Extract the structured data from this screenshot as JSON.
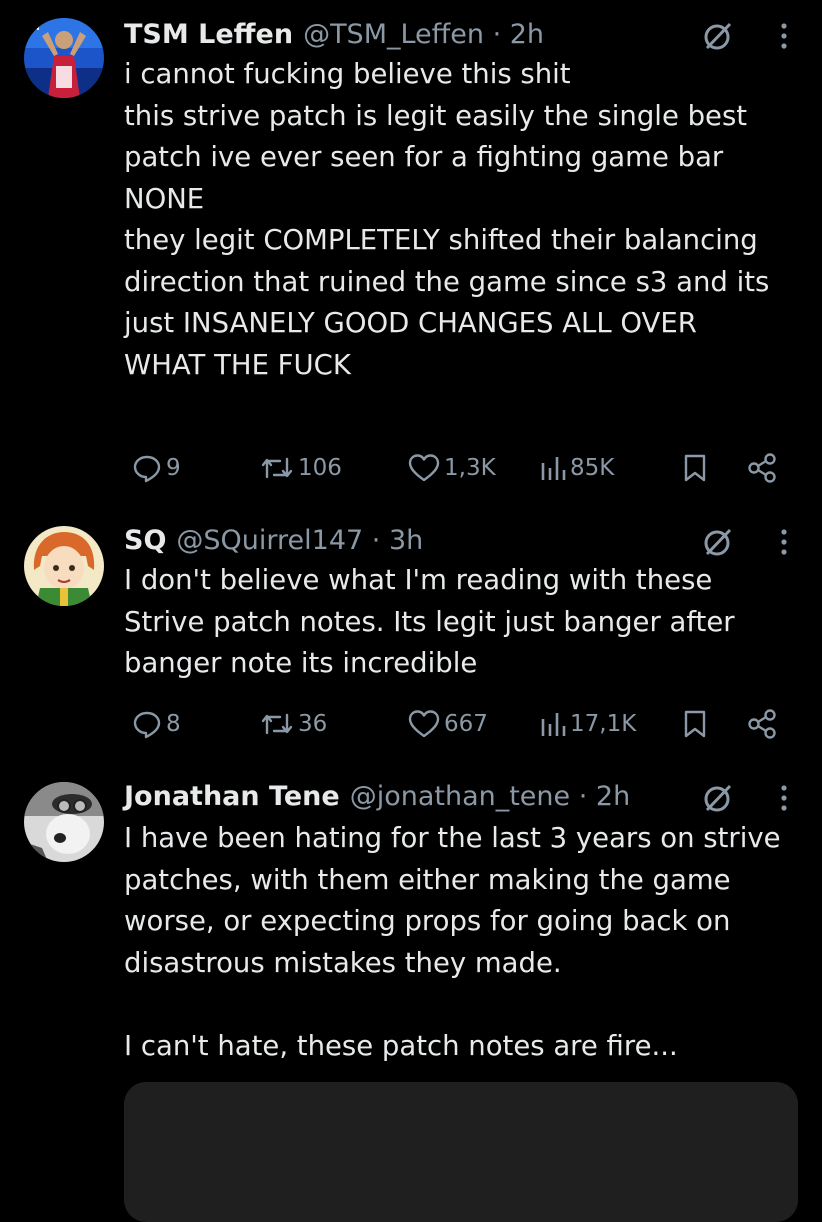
{
  "tweets": [
    {
      "name": "TSM Leffen",
      "handle": "@TSM_Leffen · 2h",
      "text": "i cannot fucking believe this shit\nthis strive patch is legit easily the single best patch ive ever seen for a fighting game bar NONE\nthey legit COMPLETELY shifted their balancing direction that ruined the game since s3 and its just INSANELY GOOD CHANGES ALL OVER\nWHAT THE FUCK",
      "replies": "9",
      "reposts": "106",
      "likes": "1,3K",
      "views": "85K"
    },
    {
      "name": "SQ",
      "handle": "@SQuirrel147 · 3h",
      "text": "I don't believe what I'm reading with these Strive patch notes. Its legit just banger after banger note its incredible",
      "replies": "8",
      "reposts": "36",
      "likes": "667",
      "views": "17,1K"
    },
    {
      "name": "Jonathan Tene",
      "handle": "@jonathan_tene · 2h",
      "text": "I have been hating for the last 3 years on strive patches, with them either making the game worse, or expecting props for going back on disastrous mistakes they made.\n\nI can't hate, these patch notes are fire..."
    }
  ],
  "icons": {
    "reply": "reply-icon",
    "repost": "repost-icon",
    "like": "heart-icon",
    "views": "views-icon",
    "bookmark": "bookmark-icon",
    "share": "share-icon",
    "grok": "grok-icon",
    "more": "more-icon"
  },
  "colors": {
    "background": "#000000",
    "text": "#e7e9ea",
    "secondary": "#8b98a5"
  }
}
